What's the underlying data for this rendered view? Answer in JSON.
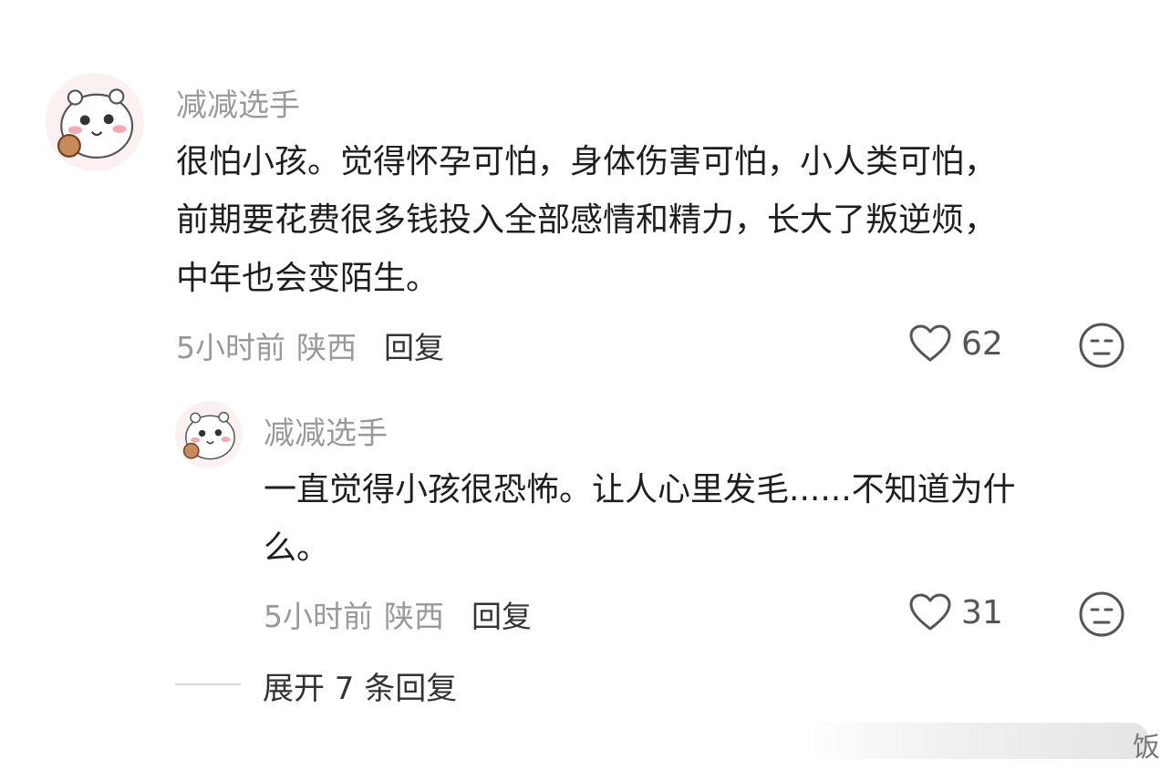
{
  "comment": {
    "author": "减减选手",
    "lines": [
      "很怕小孩。觉得怀孕可怕，身体伤害可怕，小人类可怕，",
      "前期要花费很多钱投入全部感情和精力，长大了叛逆烦，",
      "中年也会变陌生。"
    ],
    "time": "5小时前",
    "location": "陕西",
    "reply_label": "回复",
    "likes": "62"
  },
  "reply": {
    "author": "减减选手",
    "lines": [
      "一直觉得小孩很恐怖。让人心里发毛......不知道为什",
      "么。"
    ],
    "time": "5小时前",
    "location": "陕西",
    "reply_label": "回复",
    "likes": "31"
  },
  "expand_label": "展开 7 条回复",
  "watermark_text": "饭",
  "icons": {
    "avatar": "bear-avatar-icon",
    "like": "heart-outline-icon",
    "dislike": "neutral-face-icon"
  }
}
